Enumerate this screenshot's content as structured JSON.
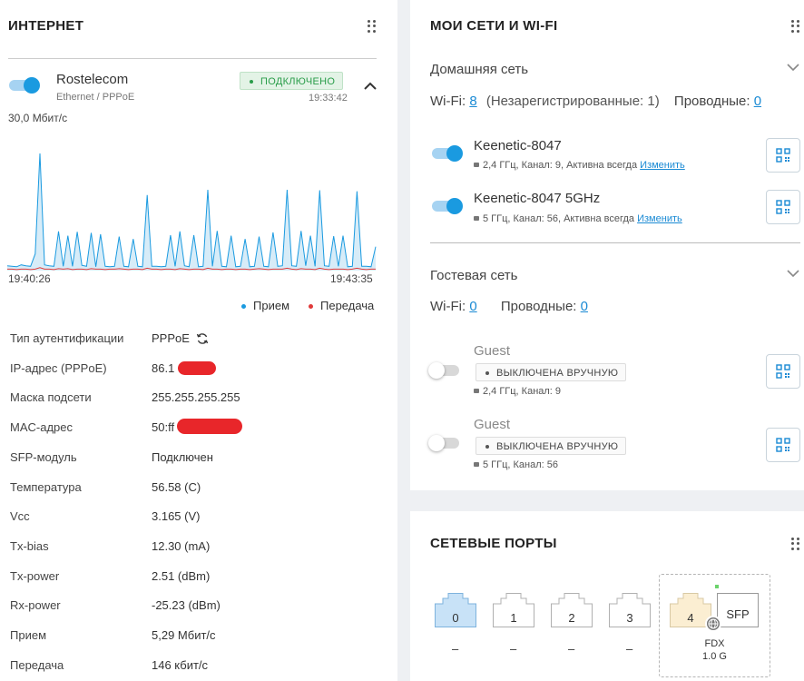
{
  "internet": {
    "title": "ИНТЕРНЕТ",
    "provider": {
      "name": "Rostelecom",
      "type": "Ethernet / PPPoE",
      "status": "ПОДКЛЮЧЕНО",
      "time": "19:33:42",
      "status_color": "#2a9d4a"
    },
    "speed_label": "30,0 Мбит/с",
    "legend": {
      "rx": "Прием",
      "tx": "Передача",
      "rx_color": "#1a9ae0",
      "tx_color": "#e03a3a"
    },
    "info": [
      {
        "key": "Тип аутентификации",
        "value": "PPPoE"
      },
      {
        "key": "IP-адрес (PPPoE)",
        "value": "86.1"
      },
      {
        "key": "Маска подсети",
        "value": "255.255.255.255"
      },
      {
        "key": "MAC-адрес",
        "value": "50:ff"
      },
      {
        "key": "SFP-модуль",
        "value": "Подключен"
      },
      {
        "key": "Температура",
        "value": "56.58 (C)"
      },
      {
        "key": "Vcc",
        "value": "3.165 (V)"
      },
      {
        "key": "Tx-bias",
        "value": "12.30 (mA)"
      },
      {
        "key": "Tx-power",
        "value": "2.51 (dBm)"
      },
      {
        "key": "Rx-power",
        "value": "-25.23 (dBm)"
      },
      {
        "key": "Прием",
        "value": "5,29 Мбит/с"
      },
      {
        "key": "Передача",
        "value": "146 кбит/с"
      }
    ]
  },
  "chart_data": {
    "type": "area",
    "title": "",
    "x_start": "19:40:26",
    "x_end": "19:43:35",
    "ylim": [
      0,
      30
    ],
    "y_unit": "Мбит/с",
    "series": [
      {
        "name": "Прием",
        "color": "#1a9ae0",
        "values": [
          1.0,
          0.9,
          0.8,
          1.2,
          1.0,
          0.9,
          3.5,
          24.5,
          1.2,
          1.0,
          0.9,
          8.2,
          0.9,
          7.3,
          0.9,
          8.1,
          1.1,
          0.9,
          7.9,
          0.8,
          7.6,
          0.9,
          0.8,
          0.9,
          7.1,
          0.9,
          0.8,
          6.6,
          0.9,
          0.8,
          15.8,
          0.9,
          0.9,
          0.8,
          0.9,
          7.4,
          0.9,
          8.2,
          1.0,
          0.8,
          7.4,
          0.8,
          0.9,
          16.9,
          0.9,
          8.3,
          0.9,
          0.8,
          7.3,
          0.8,
          0.9,
          6.6,
          0.8,
          0.9,
          7.1,
          0.9,
          0.8,
          8.0,
          0.9,
          1.0,
          16.9,
          1.0,
          0.9,
          8.3,
          1.0,
          7.3,
          0.9,
          16.8,
          1.0,
          0.9,
          7.2,
          0.9,
          7.3,
          0.8,
          0.9,
          16.6,
          0.9,
          0.9,
          0.8,
          5.0
        ]
      },
      {
        "name": "Передача",
        "color": "#e03a3a",
        "values": [
          0.3,
          0.3,
          0.2,
          0.3,
          0.3,
          0.2,
          0.3,
          0.6,
          0.3,
          0.3,
          0.2,
          0.4,
          0.3,
          0.4,
          0.2,
          0.3,
          0.3,
          0.2,
          0.4,
          0.3,
          0.3,
          0.2,
          0.3,
          0.3,
          0.4,
          0.3,
          0.2,
          0.3,
          0.3,
          0.2,
          0.5,
          0.3,
          0.3,
          0.2,
          0.3,
          0.3,
          0.2,
          0.4,
          0.3,
          0.2,
          0.3,
          0.3,
          0.2,
          0.5,
          0.3,
          0.3,
          0.2,
          0.3,
          0.3,
          0.2,
          0.3,
          0.3,
          0.2,
          0.3,
          0.4,
          0.3,
          0.2,
          0.3,
          0.3,
          0.3,
          0.5,
          0.3,
          0.2,
          0.4,
          0.3,
          0.3,
          0.2,
          0.5,
          0.3,
          0.2,
          0.3,
          0.3,
          0.3,
          0.2,
          0.3,
          0.5,
          0.3,
          0.2,
          0.3,
          0.3
        ]
      }
    ]
  },
  "networks": {
    "title": "МОИ СЕТИ И WI-FI",
    "home": {
      "title": "Домашняя сеть",
      "wifi_label": "Wi-Fi:",
      "wifi_count": "8",
      "unregistered": "(Незарегистрированные: 1)",
      "wired_label": "Проводные:",
      "wired_count": "0",
      "ssids": [
        {
          "name": "Keenetic-8047",
          "details": "2,4 ГГц,  Канал: 9, Активна всегда",
          "action": "Изменить"
        },
        {
          "name": "Keenetic-8047 5GHz",
          "details": "5 ГГц,  Канал: 56, Активна всегда",
          "action": "Изменить"
        }
      ]
    },
    "guest": {
      "title": "Гостевая сеть",
      "wifi_label": "Wi-Fi:",
      "wifi_count": "0",
      "wired_label": "Проводные:",
      "wired_count": "0",
      "ssids": [
        {
          "name": "Guest",
          "status": "ВЫКЛЮЧЕНА ВРУЧНУЮ",
          "details": "2,4 ГГц,  Канал: 9"
        },
        {
          "name": "Guest",
          "status": "ВЫКЛЮЧЕНА ВРУЧНУЮ",
          "details": "5 ГГц,  Канал: 56"
        }
      ]
    }
  },
  "ports": {
    "title": "СЕТЕВЫЕ ПОРТЫ",
    "items": [
      {
        "label": "0",
        "state": "–"
      },
      {
        "label": "1",
        "state": "–"
      },
      {
        "label": "2",
        "state": "–"
      },
      {
        "label": "3",
        "state": "–"
      },
      {
        "label": "4"
      }
    ],
    "sfp_label": "SFP",
    "sfp_duplex": "FDX",
    "sfp_speed": "1.0 G"
  }
}
